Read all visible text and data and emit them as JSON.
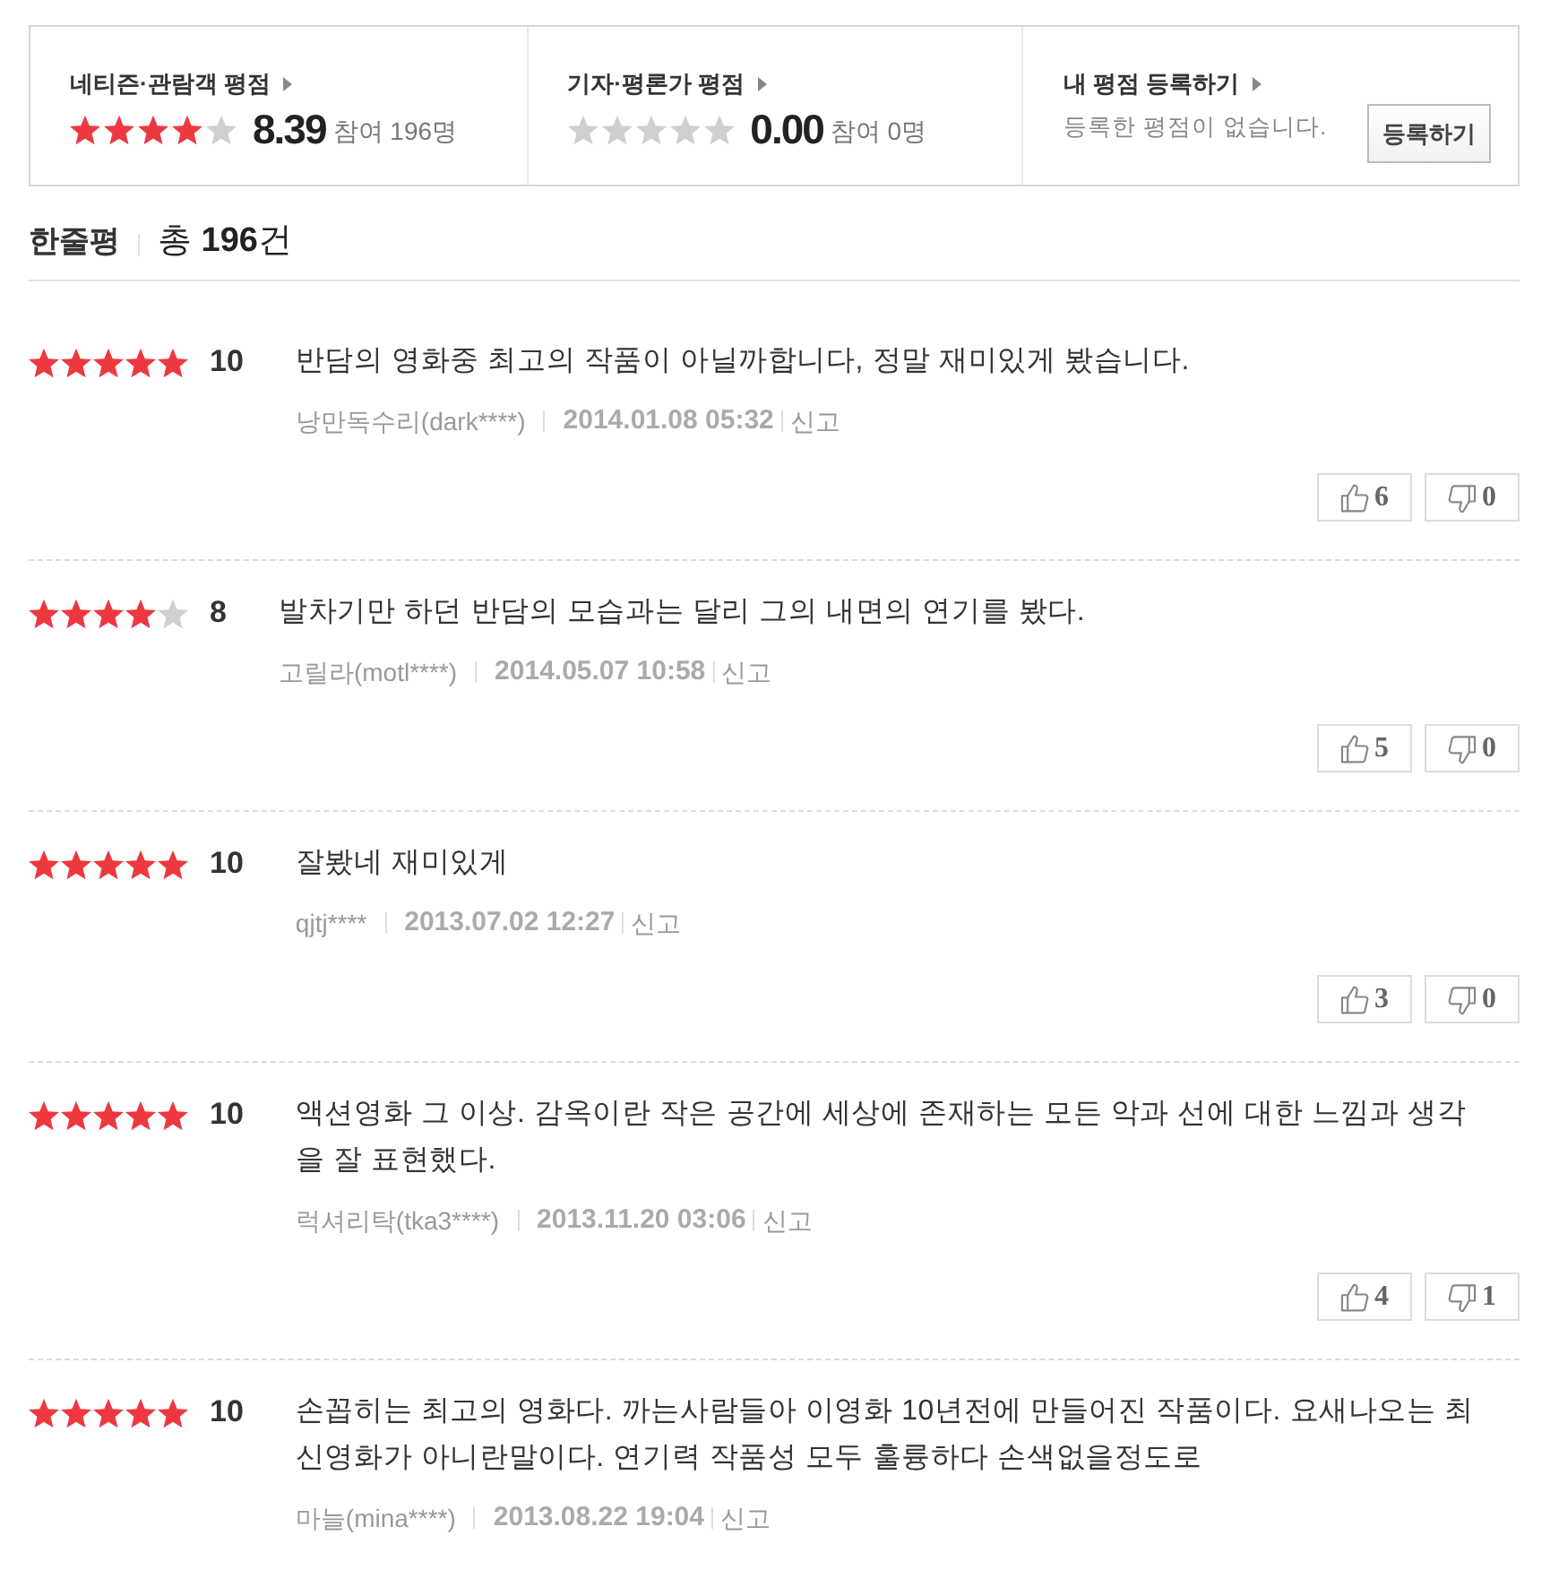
{
  "rating_summary": [
    {
      "title": "네티즌·관람객 평점",
      "stars": 4,
      "score": "8.39",
      "participants": "참여 196명"
    },
    {
      "title": "기자·평론가 평점",
      "stars": 0,
      "score": "0.00",
      "participants": "참여 0명"
    }
  ],
  "my_rating": {
    "title": "내 평점 등록하기",
    "message": "등록한 평점이 없습니다.",
    "button": "등록하기"
  },
  "reviews_header": {
    "title": "한줄평",
    "total": "총 **196**건"
  },
  "reviews": [
    {
      "stars": 5,
      "score": "10",
      "text": "반담의 영화중 최고의 작품이 아닐까합니다, 정말 재미있게 봤습니다.",
      "author": "낭만독수리(dark****)",
      "date": "2014.01.08 05:32",
      "report": "신고",
      "likes": "6",
      "dislikes": "0"
    },
    {
      "stars": 4,
      "score": "8",
      "text": "발차기만 하던 반담의 모습과는 달리 그의 내면의 연기를 봤다.",
      "author": "고릴라(motl****)",
      "date": "2014.05.07 10:58",
      "report": "신고",
      "likes": "5",
      "dislikes": "0"
    },
    {
      "stars": 5,
      "score": "10",
      "text": "잘봤네 재미있게",
      "author": "qjtj****",
      "date": "2013.07.02 12:27",
      "report": "신고",
      "likes": "3",
      "dislikes": "0"
    },
    {
      "stars": 5,
      "score": "10",
      "text": "액션영화 그 이상. 감옥이란 작은 공간에 세상에 존재하는 모든 악과 선에 대한 느낌과 생각을 잘 표현했다.",
      "author": "럭셔리탁(tka3****)",
      "date": "2013.11.20 03:06",
      "report": "신고",
      "likes": "4",
      "dislikes": "1"
    },
    {
      "stars": 5,
      "score": "10",
      "text": "손꼽히는 최고의 영화다. 까는사람들아 이영화 10년전에 만들어진 작품이다. 요새나오는 최신영화가 아니란말이다. 연기력 작품성 모두 훌륭하다 손색없을정도로",
      "author": "마늘(mina****)",
      "date": "2013.08.22 19:04",
      "report": "신고"
    }
  ]
}
